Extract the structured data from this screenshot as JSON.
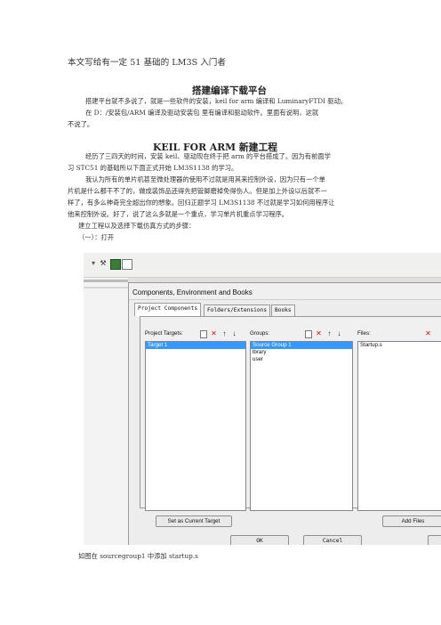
{
  "document": {
    "intro": "本文写给有一定 51 基础的 LM3S 入门者",
    "section1": {
      "heading": "搭建编译下载平台",
      "lines": [
        "搭建平台就不多说了，就是一些软件的安装，keil for arm 编译和 LuminaryFTDI 驱动。",
        "在 D：/安装包/ARM 编译及驱动安装包    里有编译和驱动软件。里面有说明，这就",
        "不说了。"
      ]
    },
    "section2": {
      "heading": "KEIL FOR ARM  新建工程",
      "lines": [
        "经历了三四天的时间，安装 keil、驱动现在终于把 arm 的平台搭成了。因为有前面学",
        "习 STC51 的基础所以下面正式开始 LM3S1138 的学习。",
        "我认为所有的单片机甚至微处理器的使用不过就是用其来控制外设，因为只有一个单",
        "片机是什么都干不了的，做成装饰品还得先把管脚磨掉免得伤人。但是加上外设以后就不一",
        "样了，有多么神奇完全超出你的想象。回归正题学习 LM3S1138 不过就是学习如何用程序让",
        "他来控制外设。好了，说了这么多就是一个重点，学习单片机重点学习程序。",
        "建立工程以及选择下载仿真方式的步骤：",
        "（一）：打开"
      ]
    },
    "caption": "如图在  sourcegroup1 中添加 startup.s"
  },
  "screenshot": {
    "dialog_title": "Components, Environment and Books",
    "tabs": [
      "Project Components",
      "Folders/Extensions",
      "Books"
    ],
    "project_targets": {
      "label": "Project Targets:",
      "items": [
        "Target 1"
      ]
    },
    "groups": {
      "label": "Groups:",
      "items": [
        "Source Group 1",
        "lbrary",
        "user"
      ]
    },
    "files": {
      "label": "Files:",
      "items": [
        "Startup.s"
      ]
    },
    "buttons": {
      "set_target": "Set as Current Target",
      "add_files": "Add Files",
      "ok": "OK",
      "cancel": "Cancel"
    },
    "colors": {
      "selection": "#3399ff",
      "delete_icon": "#cc1111"
    }
  }
}
